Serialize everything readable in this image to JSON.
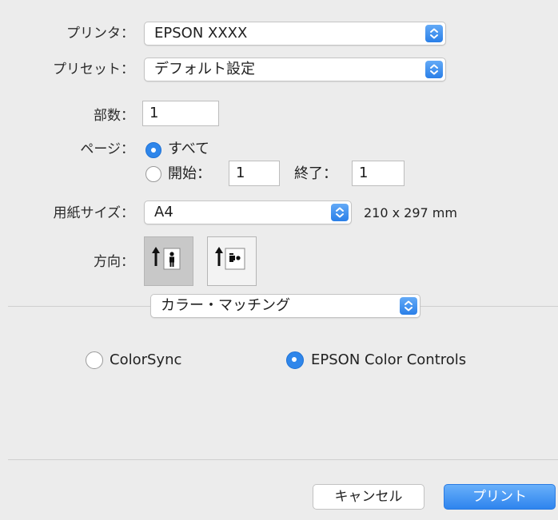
{
  "printer": {
    "label": "プリンタ：",
    "value": "EPSON XXXX"
  },
  "preset": {
    "label": "プリセット：",
    "value": "デフォルト設定"
  },
  "copies": {
    "label": "部数：",
    "value": "1"
  },
  "pages": {
    "label": "ページ：",
    "all_label": "すべて",
    "from_label": "開始：",
    "from_value": "1",
    "to_label": "終了：",
    "to_value": "1",
    "selected": "all"
  },
  "paper_size": {
    "label": "用紙サイズ：",
    "value": "A4",
    "dimensions": "210 x 297 mm"
  },
  "orientation": {
    "label": "方向：",
    "selected": "portrait"
  },
  "panel": {
    "value": "カラー・マッチング"
  },
  "color_options": {
    "colorsync_label": "ColorSync",
    "epson_label": "EPSON Color Controls",
    "selected": "epson"
  },
  "buttons": {
    "cancel": "キャンセル",
    "print": "プリント"
  },
  "colors": {
    "accent": "#2f86ea",
    "background": "#ececec"
  }
}
